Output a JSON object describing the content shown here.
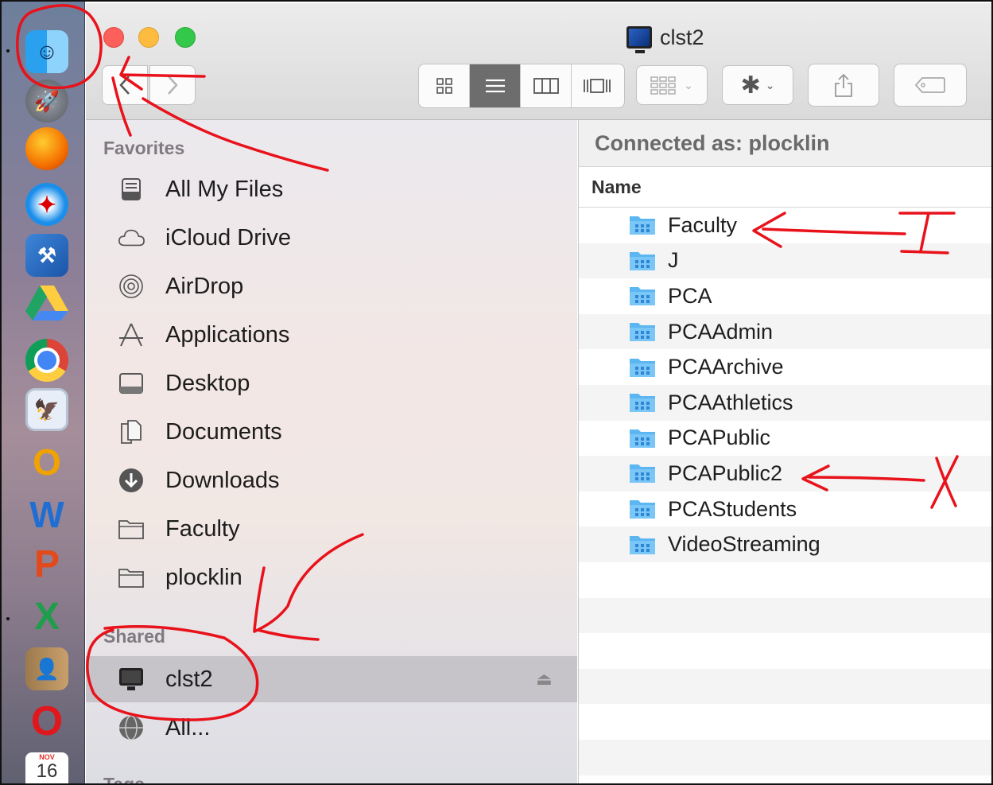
{
  "window": {
    "title": "clst2",
    "colors": {
      "close": "#fc605b",
      "minimize": "#fdbc40",
      "zoom": "#34c84a",
      "annotation": "#e8121b",
      "folder": "#5bb6f2"
    }
  },
  "toolbar": {
    "back_icon": "chevron-left-icon",
    "forward_icon": "chevron-right-icon",
    "view_modes": [
      "icon-view-icon",
      "list-view-icon",
      "column-view-icon",
      "cover-flow-icon"
    ],
    "active_view": "list-view-icon",
    "arrange_icon": "arrange-grid-icon",
    "action_icon": "gear-icon",
    "share_icon": "share-icon",
    "tag_icon": "tag-icon"
  },
  "sidebar": {
    "favorites_header": "Favorites",
    "favorites": [
      {
        "label": "All My Files",
        "icon": "all-files-icon"
      },
      {
        "label": "iCloud Drive",
        "icon": "cloud-icon"
      },
      {
        "label": "AirDrop",
        "icon": "airdrop-icon"
      },
      {
        "label": "Applications",
        "icon": "applications-icon"
      },
      {
        "label": "Desktop",
        "icon": "desktop-icon"
      },
      {
        "label": "Documents",
        "icon": "documents-icon"
      },
      {
        "label": "Downloads",
        "icon": "downloads-icon"
      },
      {
        "label": "Faculty",
        "icon": "folder-icon"
      },
      {
        "label": "plocklin",
        "icon": "folder-icon"
      }
    ],
    "shared_header": "Shared",
    "shared": [
      {
        "label": "clst2",
        "icon": "monitor-icon",
        "selected": true
      },
      {
        "label": "All...",
        "icon": "network-icon"
      }
    ],
    "tags_header": "Tags"
  },
  "main": {
    "connection": "Connected as: plocklin",
    "column_name": "Name",
    "items": [
      "Faculty",
      "J",
      "PCA",
      "PCAAdmin",
      "PCAArchive",
      "PCAAthletics",
      "PCAPublic",
      "PCAPublic2",
      "PCAStudents",
      "VideoStreaming"
    ]
  },
  "dock": {
    "apps": [
      "finder-icon",
      "launchpad-icon",
      "firefox-icon",
      "safari-icon",
      "xcode-icon",
      "google-drive-icon",
      "chrome-icon",
      "preview-icon",
      "outlook-icon",
      "word-icon",
      "powerpoint-icon",
      "excel-icon",
      "contacts-icon",
      "opera-icon",
      "calendar-icon"
    ],
    "calendar_month": "NOV",
    "calendar_day": "16"
  },
  "annotations": {
    "mark_faculty": "I",
    "mark_pcapublic2": "X"
  }
}
